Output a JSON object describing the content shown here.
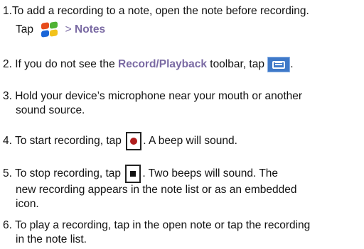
{
  "steps": [
    {
      "line1": "1.To add a recording to a note, open the note before recording.",
      "tap_word": "Tap",
      "sep": ">",
      "notes_label": "Notes"
    },
    {
      "pre": "2. If you do not see the ",
      "toolbar_label": "Record/Playback",
      "post": " toolbar, tap",
      "end": "."
    },
    {
      "line1": "3. Hold your device’s microphone near your mouth or another",
      "line2": "sound source."
    },
    {
      "pre": "4. To start recording, tap",
      "post": ". A beep will sound."
    },
    {
      "pre": "5. To stop recording, tap",
      "post": ". Two beeps will sound. The",
      "line2": "new recording appears in the note list or as an embedded",
      "line3": "icon."
    },
    {
      "line1": "6. To play a recording, tap  in the open note or tap the recording",
      "line2": "in the note list."
    }
  ],
  "icons": [
    "windows-start-icon",
    "record-playback-toolbar-icon",
    "record-icon",
    "stop-icon"
  ],
  "colors": {
    "highlight": "#7a6aa3",
    "record": "#b01e1e"
  }
}
